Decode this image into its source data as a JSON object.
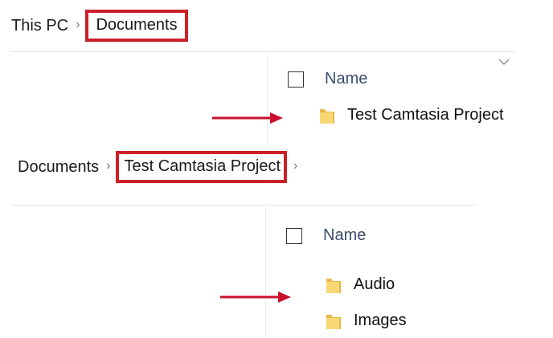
{
  "panel_1": {
    "breadcrumb": [
      "This PC",
      "Documents"
    ],
    "column_header": "Name",
    "items": [
      {
        "label": "Test Camtasia Project",
        "icon": "folder-icon"
      }
    ]
  },
  "panel_2": {
    "breadcrumb": [
      "Documents",
      "Test Camtasia Project"
    ],
    "column_header": "Name",
    "items": [
      {
        "label": "Audio",
        "icon": "folder-icon"
      },
      {
        "label": "Images",
        "icon": "folder-icon"
      }
    ]
  },
  "colors": {
    "highlight": "#cc2027",
    "arrow": "#c8102e",
    "folder": "#f8d775",
    "header_text": "#3b4e6b"
  }
}
